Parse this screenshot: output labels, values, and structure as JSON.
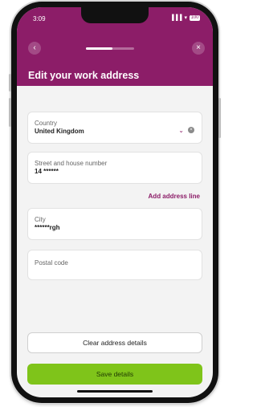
{
  "status_bar": {
    "time": "3:09",
    "signal": "▐▐▐",
    "wifi": "▾",
    "battery": "100"
  },
  "header": {
    "title": "Edit your work address",
    "progress": 0.55
  },
  "form": {
    "country": {
      "label": "Country",
      "value": "United Kingdom"
    },
    "street": {
      "label": "Street and house number",
      "value": "14 ******"
    },
    "add_line_label": "Add address line",
    "city": {
      "label": "City",
      "value": "******rgh"
    },
    "postal": {
      "label": "Postal code",
      "value": ""
    }
  },
  "buttons": {
    "clear": "Clear address details",
    "save": "Save details"
  },
  "colors": {
    "brand": "#8c1d68",
    "accent_green": "#7fc41a"
  }
}
